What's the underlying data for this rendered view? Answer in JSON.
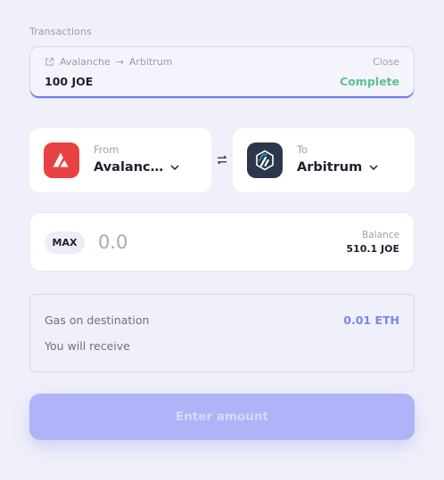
{
  "section": {
    "label": "Transactions"
  },
  "transaction": {
    "from_chain": "Avalanche",
    "arrow": "→",
    "to_chain": "Arbitrum",
    "close_label": "Close",
    "amount": "100 JOE",
    "status": "Complete",
    "status_color": "#5cc08f",
    "icon": "external-link-icon"
  },
  "from": {
    "label": "From",
    "chain": "Avalanc…",
    "icon": "avalanche-logo"
  },
  "to": {
    "label": "To",
    "chain": "Arbitrum",
    "icon": "arbitrum-logo"
  },
  "swap": {
    "icon": "swap-arrows-icon"
  },
  "amount": {
    "max_label": "MAX",
    "placeholder": "0.0",
    "balance_label": "Balance",
    "balance_value": "510.1 JOE"
  },
  "info": {
    "gas_label": "Gas on destination",
    "gas_value": "0.01 ETH",
    "receive_label": "You will receive"
  },
  "submit": {
    "label": "Enter amount"
  },
  "colors": {
    "accent": "#7a84f3",
    "button_disabled": "#aeb4f7",
    "avalanche": "#e84142",
    "arbitrum": "#2d374b"
  }
}
